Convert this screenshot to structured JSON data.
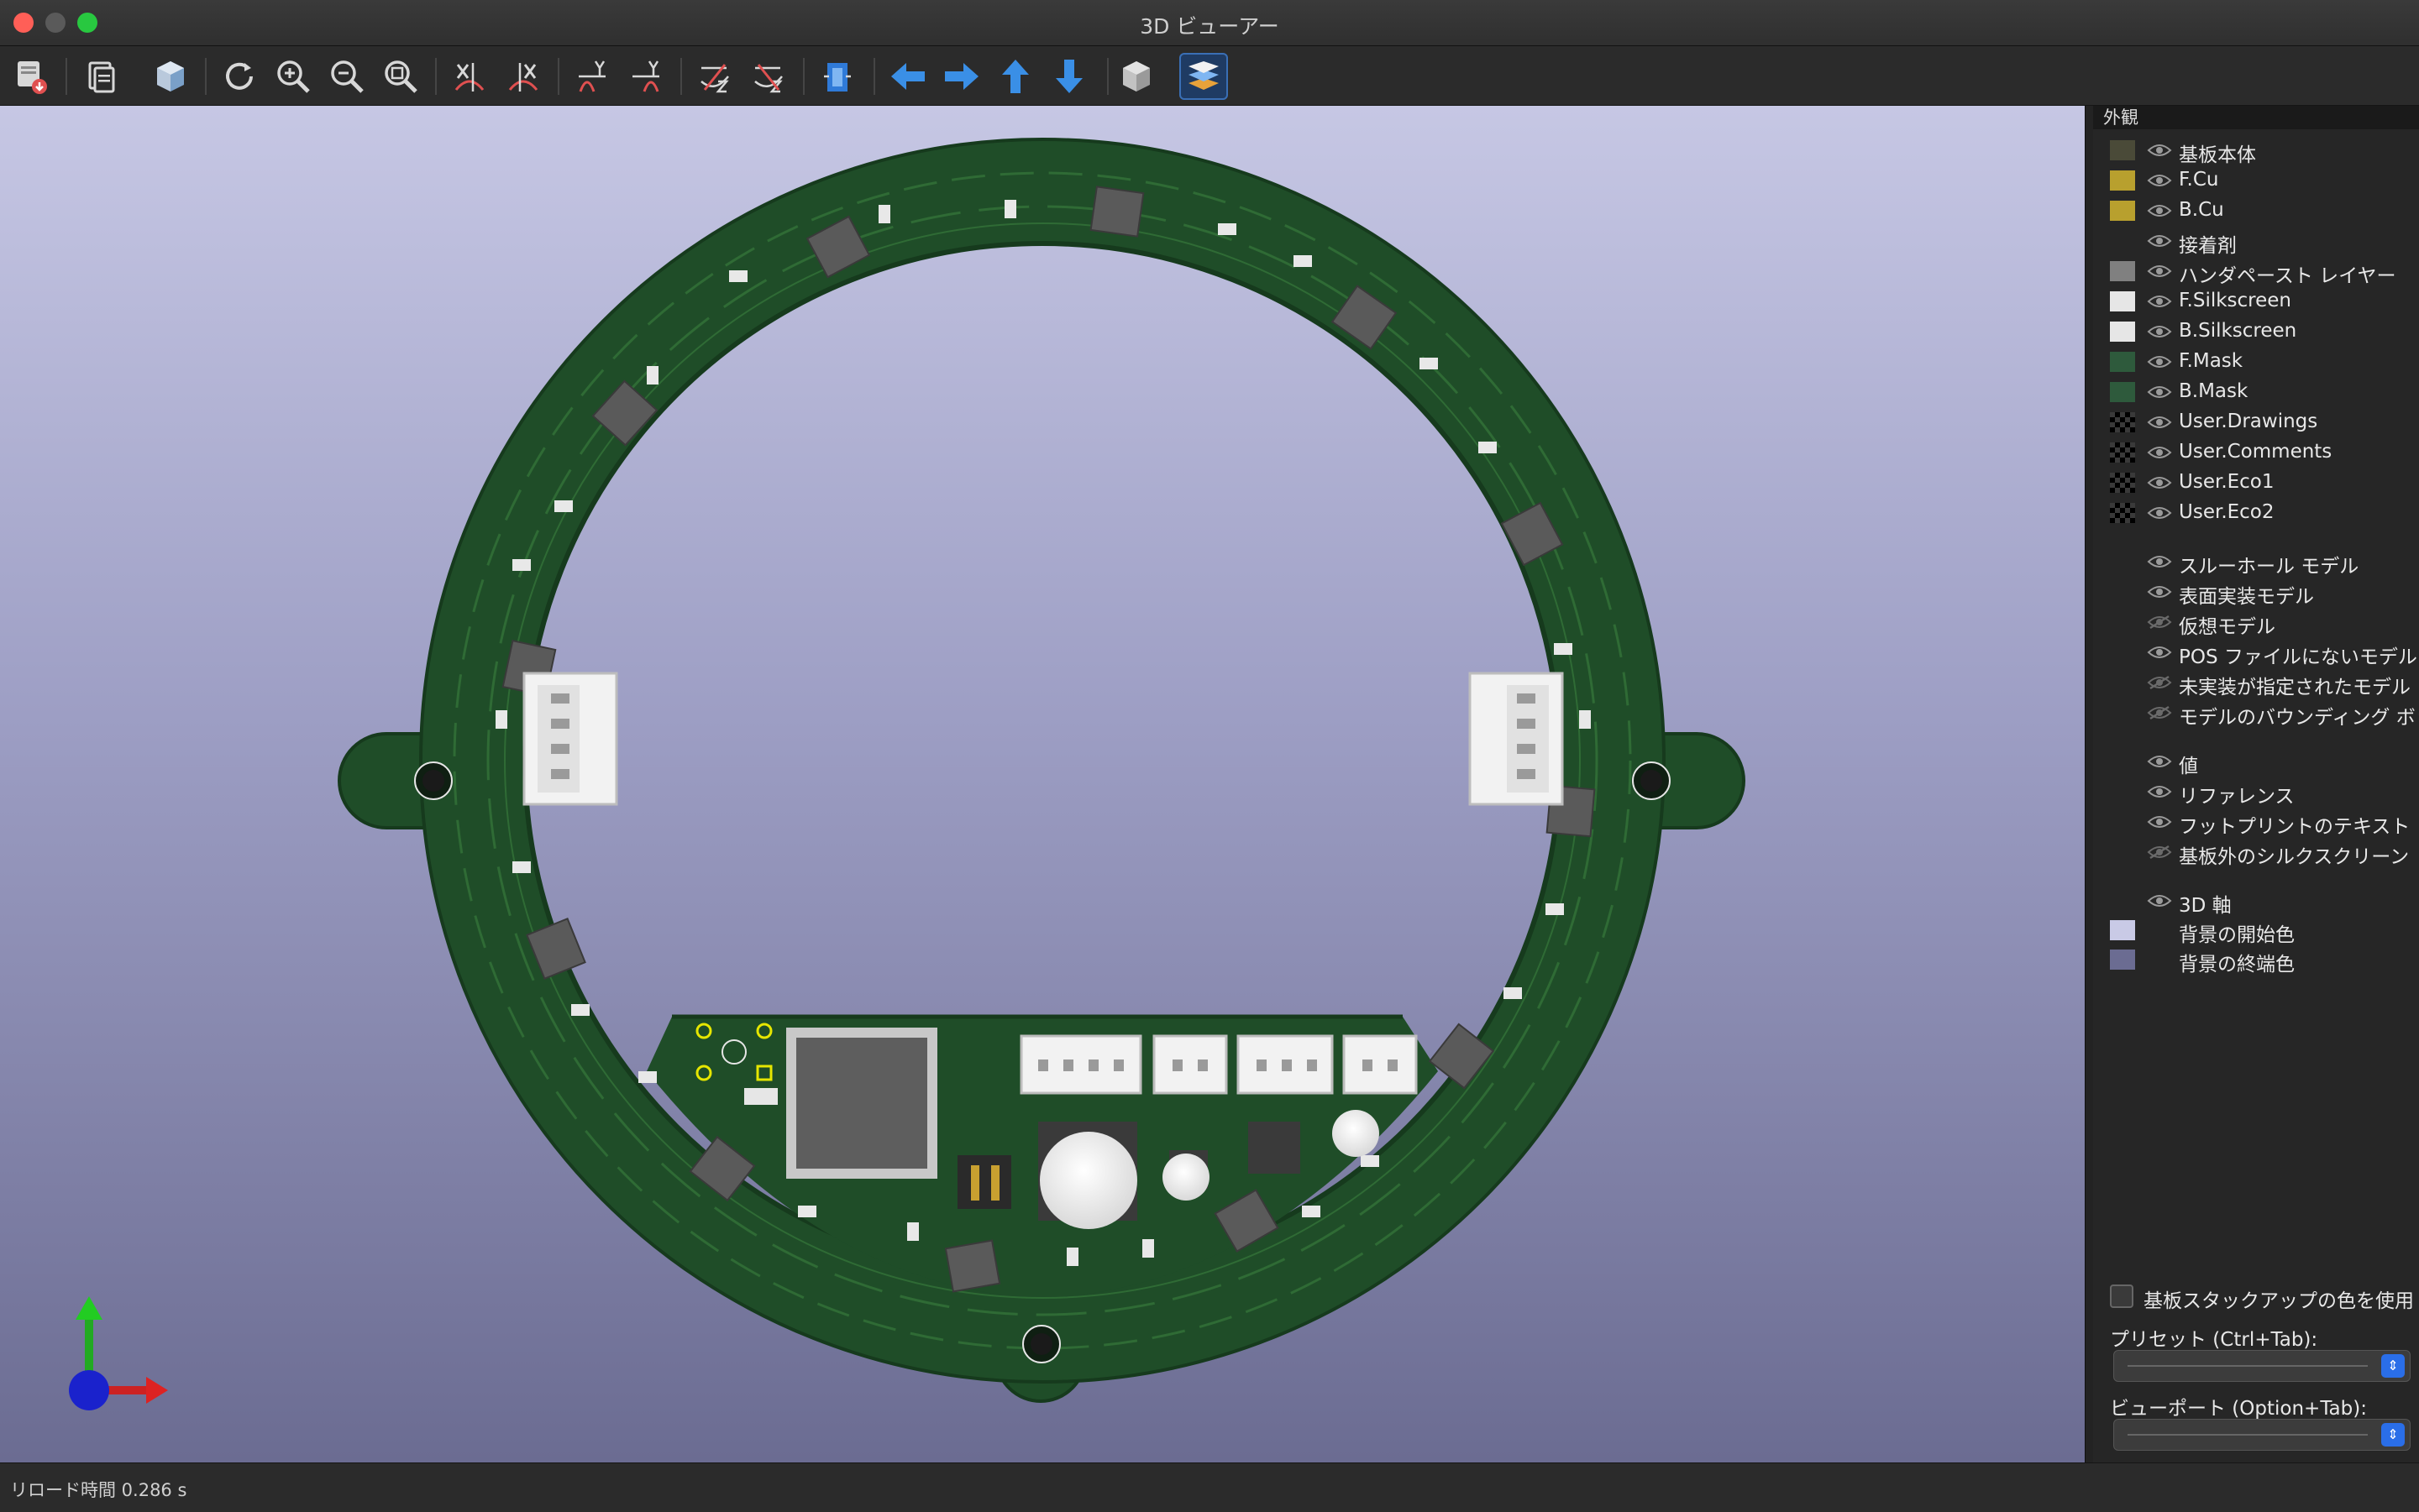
{
  "window": {
    "title": "3D ビューアー"
  },
  "toolbar": {
    "buttons": [
      {
        "name": "export-image"
      },
      {
        "name": "copy"
      },
      {
        "name": "raytrace"
      },
      {
        "name": "reload"
      },
      {
        "name": "zoom-in"
      },
      {
        "name": "zoom-out"
      },
      {
        "name": "zoom-fit"
      },
      {
        "name": "rotate-x-cw"
      },
      {
        "name": "rotate-x-ccw"
      },
      {
        "name": "rotate-y-cw"
      },
      {
        "name": "rotate-y-ccw"
      },
      {
        "name": "rotate-z-cw"
      },
      {
        "name": "rotate-z-ccw"
      },
      {
        "name": "flip-board"
      },
      {
        "name": "pan-left"
      },
      {
        "name": "pan-right"
      },
      {
        "name": "pan-up"
      },
      {
        "name": "pan-down"
      },
      {
        "name": "orthographic"
      },
      {
        "name": "layers-panel"
      }
    ]
  },
  "panel": {
    "title": "外観",
    "layers": [
      {
        "label": "基板本体",
        "color": "#4a4a38",
        "visible": true
      },
      {
        "label": "F.Cu",
        "color": "#b8a02e",
        "visible": true
      },
      {
        "label": "B.Cu",
        "color": "#b8a02e",
        "visible": true
      },
      {
        "label": "接着剤",
        "color": "",
        "visible": true
      },
      {
        "label": "ハンダペースト レイヤー",
        "color": "#808080",
        "visible": true
      },
      {
        "label": "F.Silkscreen",
        "color": "#e6e6e6",
        "visible": true
      },
      {
        "label": "B.Silkscreen",
        "color": "#e6e6e6",
        "visible": true
      },
      {
        "label": "F.Mask",
        "color": "#2e5a3c",
        "visible": true
      },
      {
        "label": "B.Mask",
        "color": "#2e5a3c",
        "visible": true
      },
      {
        "label": "User.Drawings",
        "color": "checker",
        "visible": true
      },
      {
        "label": "User.Comments",
        "color": "checker",
        "visible": true
      },
      {
        "label": "User.Eco1",
        "color": "checker",
        "visible": true
      },
      {
        "label": "User.Eco2",
        "color": "checker",
        "visible": true
      }
    ],
    "models": [
      {
        "label": "スルーホール モデル",
        "visible": true
      },
      {
        "label": "表面実装モデル",
        "visible": true
      },
      {
        "label": "仮想モデル",
        "visible": false
      },
      {
        "label": "POS ファイルにないモデル",
        "visible": true
      },
      {
        "label": "未実装が指定されたモデル",
        "visible": false
      },
      {
        "label": "モデルのバウンディング ボッ",
        "visible": false
      }
    ],
    "texts": [
      {
        "label": "値",
        "visible": true
      },
      {
        "label": "リファレンス",
        "visible": true
      },
      {
        "label": "フットプリントのテキスト",
        "visible": true
      },
      {
        "label": "基板外のシルクスクリーン",
        "visible": false
      }
    ],
    "misc": [
      {
        "label": "3D 軸",
        "color": "",
        "visible": true
      },
      {
        "label": "背景の開始色",
        "color": "#c9cae6",
        "visible": null
      },
      {
        "label": "背景の終端色",
        "color": "#6b6c92",
        "visible": null
      }
    ],
    "use_stackup_colors": "基板スタックアップの色を使用",
    "preset_label": "プリセット (Ctrl+Tab):",
    "viewport_label": "ビューポート (Option+Tab):"
  },
  "status": {
    "reload_time": "リロード時間 0.286 s"
  },
  "colors": {
    "board": "#1f4d28",
    "board_edge": "#163a1d",
    "trace": "#2f6b35",
    "chip": "#5a5a5a",
    "connector": "#f2f2f2"
  }
}
